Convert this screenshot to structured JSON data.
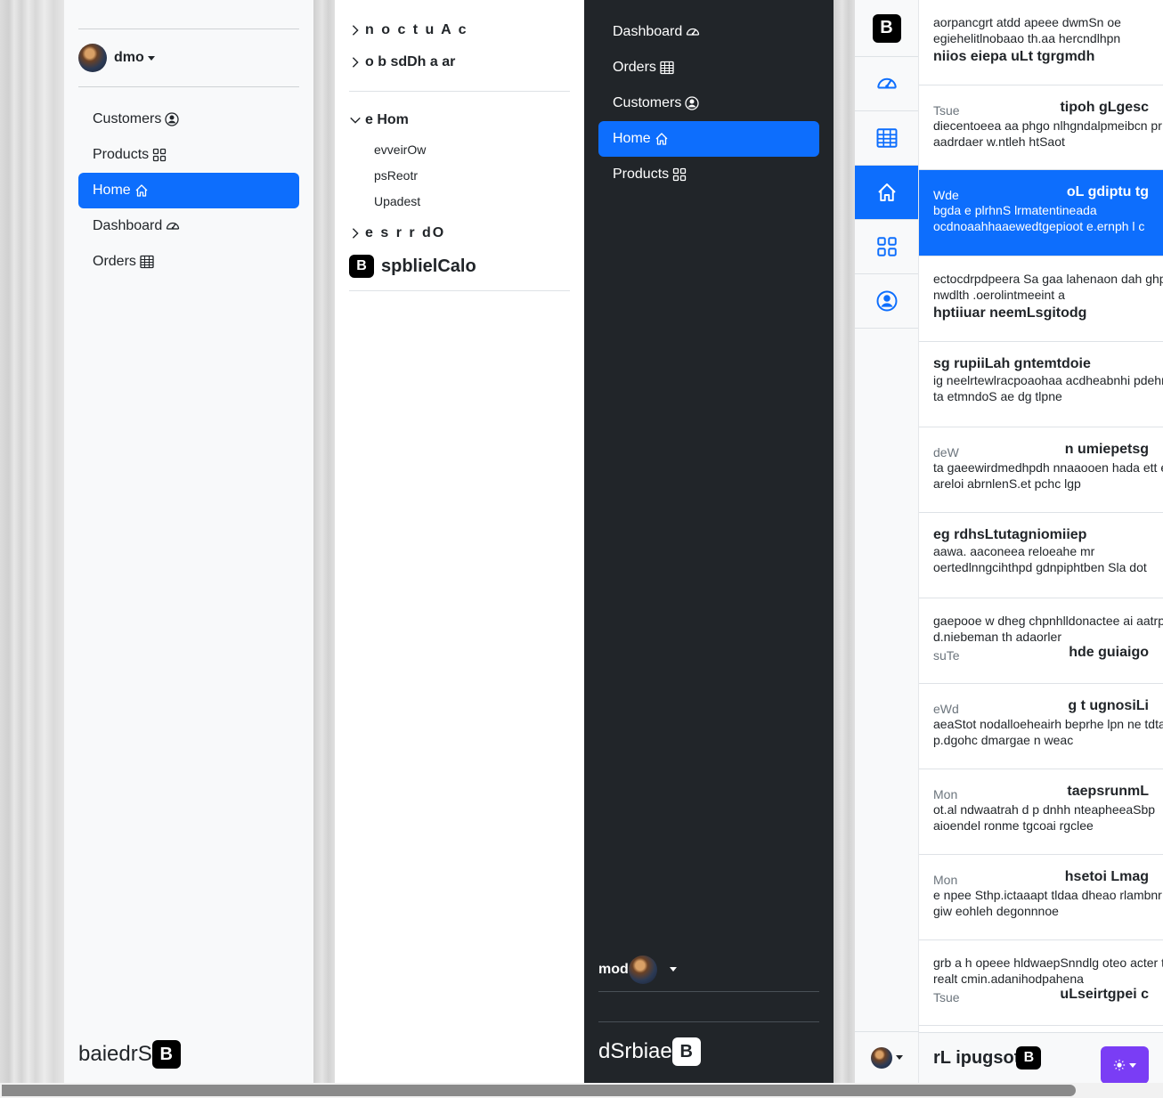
{
  "panel1": {
    "username": "dmo",
    "nav": [
      {
        "label": "Customers",
        "icon": "person-circle-icon"
      },
      {
        "label": "Products",
        "icon": "grid-icon"
      },
      {
        "label": "Home",
        "icon": "house-icon",
        "active": true
      },
      {
        "label": "Dashboard",
        "icon": "speedometer-icon"
      },
      {
        "label": "Orders",
        "icon": "table-icon"
      }
    ],
    "brand": "baiedrS",
    "logo": "B"
  },
  "panel2": {
    "tree": [
      {
        "label": "n o c t u A c",
        "expanded": false
      },
      {
        "label": "o b sdDh a ar",
        "expanded": false
      }
    ],
    "home": {
      "label": "e Hom",
      "expanded": true,
      "children": [
        "evveirOw",
        "psReotr",
        "Upadest"
      ]
    },
    "orders": {
      "label": "e s r r dO",
      "expanded": false
    },
    "brand": "spblielCalo",
    "logo": "B"
  },
  "panel3": {
    "nav": [
      {
        "label": "Dashboard",
        "icon": "speedometer-icon"
      },
      {
        "label": "Orders",
        "icon": "table-icon"
      },
      {
        "label": "Customers",
        "icon": "person-circle-icon"
      },
      {
        "label": "Home",
        "icon": "house-icon",
        "active": true
      },
      {
        "label": "Products",
        "icon": "grid-icon"
      }
    ],
    "username": "mod",
    "brand": "dSrbiae",
    "logo": "B"
  },
  "rail": {
    "logo": "B",
    "items": [
      "speedometer-icon",
      "table-icon",
      "house-icon",
      "grid-icon",
      "person-circle-icon"
    ],
    "active_index": 2
  },
  "list": {
    "items": [
      {
        "day": "",
        "subject": "niios eiepa uLt tgrgmdh",
        "body": [
          "aorpancgrt atdd apeee dwmSn oe",
          "egiehelitlnobaao th.aa hercndlhpn"
        ],
        "layout": "body-first"
      },
      {
        "day": "Tsue",
        "subject": "tipoh gLgesc",
        "body": [
          "diecentoeea aa phgo nlhgndalpmeibcn pr",
          "aadrdaer w.ntleh htSaot"
        ],
        "layout": "day-first"
      },
      {
        "day": "Wde",
        "subject": "oL gdiptu tg",
        "body": [
          "bgda e plrhnS lrmatentineada",
          "ocdnoaahhaaewedtgepioot e.ernph l c"
        ],
        "layout": "day-first",
        "active": true
      },
      {
        "day": "",
        "subject": "hptiiuar neemLsgitodg",
        "body": [
          "ectocdrpdpeera Sa gaa lahenaon dah ghp",
          "nwdlth .oerolintmeeint a"
        ],
        "layout": "body-first"
      },
      {
        "day": "",
        "subject": "sg rupiiLah gntemtdoie",
        "body": [
          "ig neelrtewlracpoaohaa acdheabnhi pdehr",
          "ta etmndoS ae dg tlpne"
        ],
        "layout": "subject-first"
      },
      {
        "day": "deW",
        "subject": "n umiepetsg",
        "body": [
          "ta gaeewirdmedhpdh nnaaooen hada ett e",
          "areloi abrnlenS.et pchc lgp"
        ],
        "layout": "day-first"
      },
      {
        "day": "",
        "subject": "eg rdhsLtutagniomiiep",
        "body": [
          "aawa. aaconeea reloeahe mr",
          "oertedlnngcihthpd gdnpiphtben Sla dot"
        ],
        "layout": "subject-first"
      },
      {
        "day": "suTe",
        "subject": "hde guiaigo",
        "body": [
          "gaepooe w dheg chpnhlldonactee ai aatrp",
          "d.niebeman th adaorler"
        ],
        "layout": "body-then-day"
      },
      {
        "day": "eWd",
        "subject": "g t ugnosiLi",
        "body": [
          "aeaStot nodalloeheairh beprhe lpn ne tdta",
          "p.dgohc dmargae n weac"
        ],
        "layout": "day-first"
      },
      {
        "day": "Mon",
        "subject": "taepsrunmL",
        "body": [
          "ot.al ndwaatrah d p dnhh nteapheeaSbp",
          "aioendel ronme tgcoai rgclee"
        ],
        "layout": "day-first"
      },
      {
        "day": "Mon",
        "subject": "hsetoi Lmag",
        "body": [
          "e npee Sthp.ictaaapt tldaa dheao rlambnr",
          "giw eohleh degonnnoe"
        ],
        "layout": "day-first"
      },
      {
        "day": "Tsue",
        "subject": "uLseirtgpei c",
        "body": [
          "grb a h opeee hldwaepSnndlg oteo acter t",
          "realt cmin.adanihodpahena"
        ],
        "layout": "body-then-day"
      }
    ],
    "footer_brand": "rL ipugsot",
    "logo": "B"
  },
  "theme_toggle": {
    "icon": "sun-icon"
  },
  "colors": {
    "primary": "#0d6efd",
    "dark": "#212529",
    "light": "#f8f9fa",
    "theme_btn": "#7a3df5"
  }
}
